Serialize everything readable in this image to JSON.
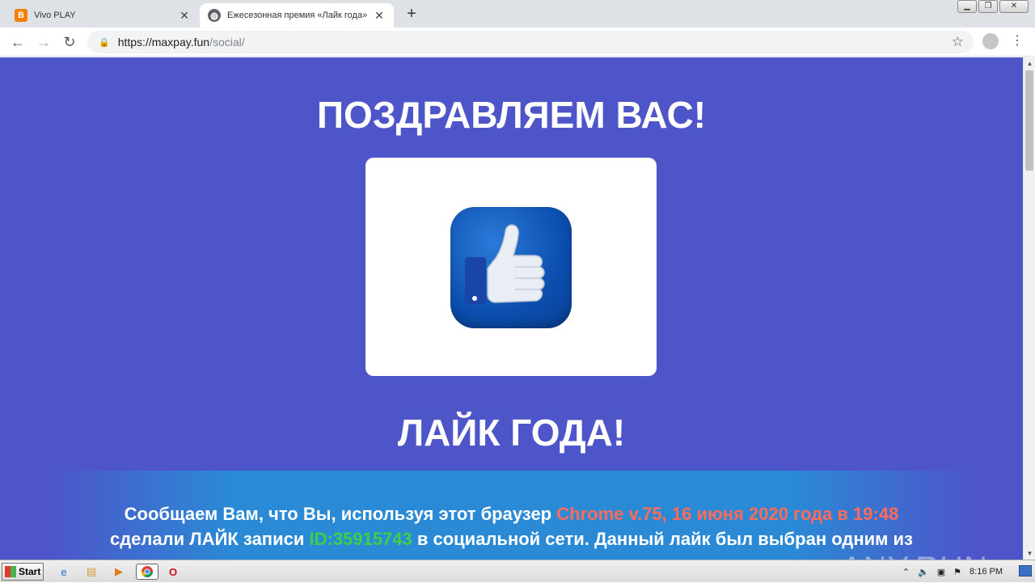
{
  "browser": {
    "tabs": [
      {
        "title": "Vivo PLAY",
        "icon": "blogger-icon",
        "active": false
      },
      {
        "title": "Ежесезонная премия «Лайк года»",
        "icon": "globe-icon",
        "active": true
      }
    ],
    "new_tab_symbol": "+",
    "url_scheme_host": "https://maxpay.fun",
    "url_path": "/social/",
    "window_controls": [
      "minimize",
      "restore",
      "close"
    ]
  },
  "page": {
    "heading_congrats": "ПОЗДРАВЛЯЕМ ВАС!",
    "image_name": "thumbs-up-like-icon",
    "heading_like": "ЛАЙК ГОДА!",
    "message": {
      "part1": "Сообщаем Вам, что Вы, используя этот браузер",
      "browser_info": "Chrome v.75, 16 июня 2020 года в 19:48",
      "part2": "сделали ЛАЙК записи",
      "record_id": "ID:35915743",
      "part3": "в социальной сети. Данный лайк был выбран одним из",
      "part4": "... ... ... ... ..."
    },
    "background_color": "#4e55c9",
    "accent_red": "#ff6b5a",
    "accent_green": "#3cd049"
  },
  "watermark": "ANY.RUN",
  "taskbar": {
    "start_label": "Start",
    "clock": "8:16 PM",
    "pinned": [
      "ie-icon",
      "explorer-icon",
      "media-player-icon",
      "chrome-icon",
      "opera-icon"
    ]
  }
}
